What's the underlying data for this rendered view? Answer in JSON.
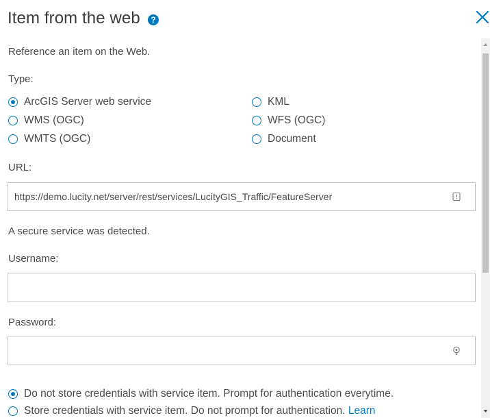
{
  "dialog": {
    "title": "Item from the web",
    "help_icon": "help-circle-icon",
    "close_icon": "close-x-icon"
  },
  "description": "Reference an item on the Web.",
  "type_section": {
    "label": "Type:",
    "options": [
      {
        "label": "ArcGIS Server web service",
        "checked": true
      },
      {
        "label": "WMS (OGC)",
        "checked": false
      },
      {
        "label": "WMTS (OGC)",
        "checked": false
      },
      {
        "label": "KML",
        "checked": false
      },
      {
        "label": "WFS (OGC)",
        "checked": false
      },
      {
        "label": "Document",
        "checked": false
      }
    ]
  },
  "url": {
    "label": "URL:",
    "value": "https://demo.lucity.net/server/rest/services/LucityGIS_Traffic/FeatureServer",
    "icon": "field-info-icon"
  },
  "secure_notice": "A secure service was detected.",
  "username": {
    "label": "Username:",
    "value": ""
  },
  "password": {
    "label": "Password:",
    "value": "",
    "icon": "key-icon"
  },
  "credentials": {
    "options": [
      {
        "label": "Do not store credentials with service item. Prompt for authentication everytime.",
        "checked": true
      },
      {
        "label": "Store credentials with service item. Do not prompt for authentication.",
        "link": "Learn",
        "checked": false
      }
    ]
  },
  "colors": {
    "accent": "#0079c1",
    "text": "#4a4a4a",
    "border": "#c6c6c6"
  }
}
